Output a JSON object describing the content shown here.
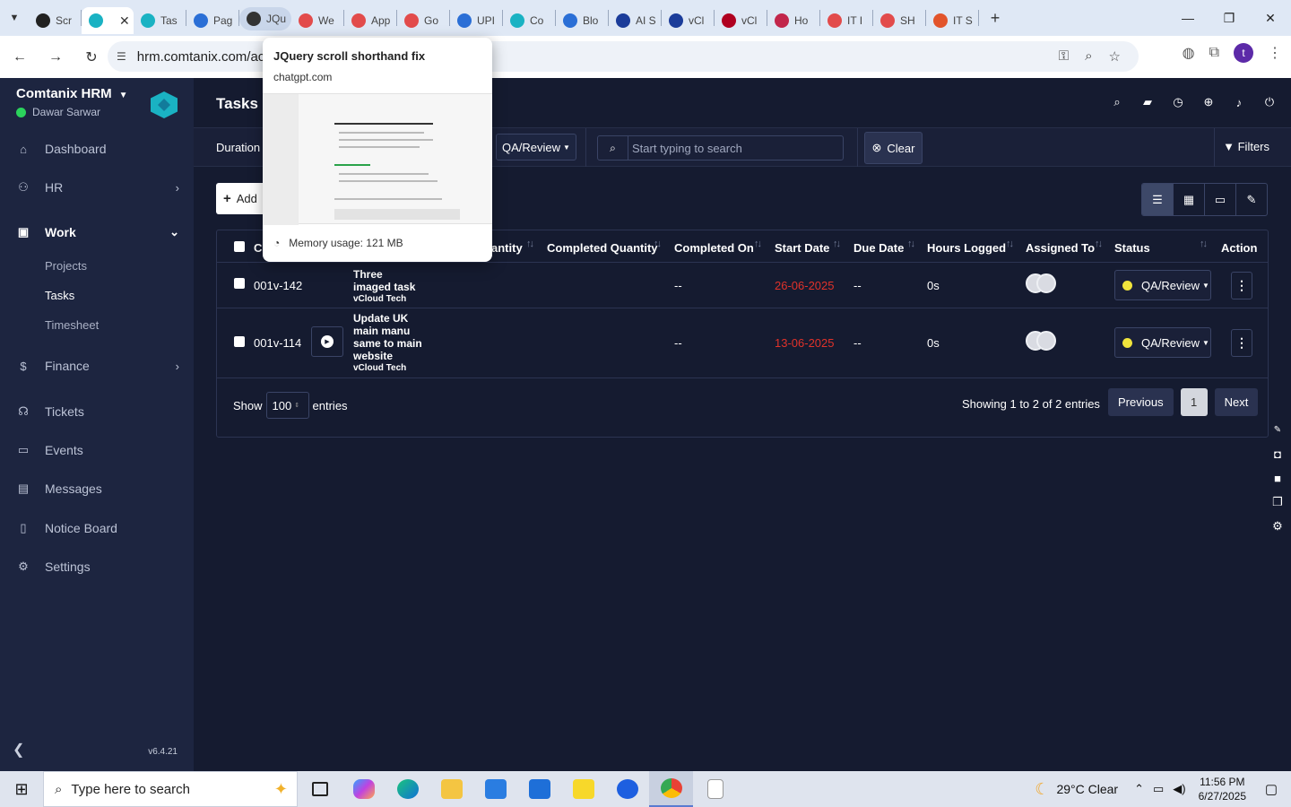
{
  "browser": {
    "tabs": [
      {
        "label": "Scr",
        "color": "#222222"
      },
      {
        "label": "",
        "color": "#1ab2c3",
        "active": true
      },
      {
        "label": "Tas",
        "color": "#1ab2c3"
      },
      {
        "label": "Pag",
        "color": "#2b6fd6"
      },
      {
        "label": "JQu",
        "color": "#333333",
        "hovered": true
      },
      {
        "label": "We",
        "color": "#e24b4b"
      },
      {
        "label": "App",
        "color": "#e24b4b"
      },
      {
        "label": "Go",
        "color": "#e24b4b"
      },
      {
        "label": "UPI",
        "color": "#2b6fd6"
      },
      {
        "label": "Co",
        "color": "#1ab2c3"
      },
      {
        "label": "Blo",
        "color": "#2b6fd6"
      },
      {
        "label": "AI S",
        "color": "#1b3c9a"
      },
      {
        "label": "vCl",
        "color": "#1b3c9a"
      },
      {
        "label": "vCl",
        "color": "#b00020"
      },
      {
        "label": "Ho",
        "color": "#c2264b"
      },
      {
        "label": "IT I",
        "color": "#e24b4b"
      },
      {
        "label": "SH",
        "color": "#e24b4b"
      },
      {
        "label": "IT S",
        "color": "#e2542b"
      }
    ],
    "url": "hrm.comtanix.com/ac",
    "profile_initial": "t"
  },
  "hovercard": {
    "title": "JQuery scroll shorthand fix",
    "domain": "chatgpt.com",
    "memory": "Memory usage: 121 MB"
  },
  "sidebar": {
    "brand": "Comtanix HRM",
    "user": "Dawar Sarwar",
    "menu": {
      "dashboard": "Dashboard",
      "hr": "HR",
      "work": "Work",
      "projects": "Projects",
      "tasks": "Tasks",
      "timesheet": "Timesheet",
      "finance": "Finance",
      "tickets": "Tickets",
      "events": "Events",
      "messages": "Messages",
      "notice_board": "Notice Board",
      "settings": "Settings"
    },
    "version": "v6.4.21"
  },
  "header": {
    "title": "Tasks"
  },
  "filters": {
    "duration_label": "Duration",
    "status_value": "QA/Review",
    "search_placeholder": "Start typing to search",
    "clear_label": "Clear",
    "filters_label": "Filters"
  },
  "toolbar": {
    "add_label": "Add"
  },
  "table": {
    "columns": {
      "code": "C",
      "quantity": "antity",
      "completed_quantity": "Completed Quantity",
      "completed_on": "Completed On",
      "start_date": "Start Date",
      "due_date": "Due Date",
      "hours_logged": "Hours Logged",
      "assigned_to": "Assigned To",
      "status": "Status",
      "action": "Action"
    },
    "rows": [
      {
        "code": "001v-142",
        "task_lines": [
          "Three",
          "imaged task"
        ],
        "client": "vCloud Tech",
        "completed_on": "--",
        "start_date": "26-06-2025",
        "due_date": "--",
        "hours_logged": "0s",
        "status": "QA/Review"
      },
      {
        "code": "001v-114",
        "task_lines": [
          "Update UK",
          "main manu",
          "same to main",
          "website"
        ],
        "client": "vCloud Tech",
        "completed_on": "--",
        "start_date": "13-06-2025",
        "due_date": "--",
        "hours_logged": "0s",
        "status": "QA/Review"
      }
    ],
    "footer": {
      "show": "Show",
      "entries_value": "100",
      "entries": "entries",
      "showing": "Showing 1 to 2 of 2 entries",
      "previous": "Previous",
      "current_page": "1",
      "next": "Next"
    }
  },
  "taskbar": {
    "search_placeholder": "Type here to search",
    "weather": "29°C  Clear",
    "time": "11:56 PM",
    "date": "6/27/2025"
  },
  "colors": {
    "background": "#151b30",
    "sidebar": "#1d2540",
    "overdue_date": "#e0322a",
    "status_dot": "#f0e43c",
    "online": "#2bd35c",
    "brand_accent": "#1ab2c3"
  }
}
